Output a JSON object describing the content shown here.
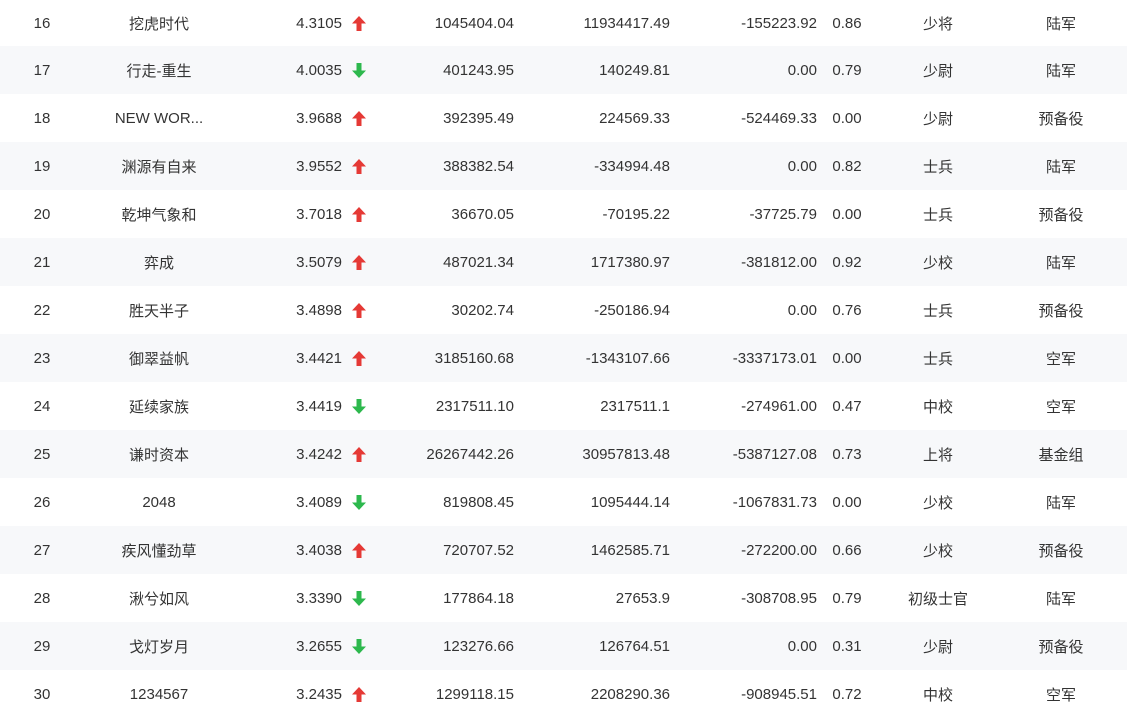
{
  "colors": {
    "up": "#e53935",
    "down": "#2db84d",
    "stripe": "#f7f8fa"
  },
  "rows": [
    {
      "rank": "16",
      "name": "挖虎时代",
      "score": "4.3105",
      "trend": "up",
      "v1": "1045404.04",
      "v2": "11934417.49",
      "v3": "-155223.92",
      "ratio": "0.86",
      "title": "少将",
      "unit": "陆军"
    },
    {
      "rank": "17",
      "name": "行走-重生",
      "score": "4.0035",
      "trend": "down",
      "v1": "401243.95",
      "v2": "140249.81",
      "v3": "0.00",
      "ratio": "0.79",
      "title": "少尉",
      "unit": "陆军"
    },
    {
      "rank": "18",
      "name": "NEW WOR...",
      "score": "3.9688",
      "trend": "up",
      "v1": "392395.49",
      "v2": "224569.33",
      "v3": "-524469.33",
      "ratio": "0.00",
      "title": "少尉",
      "unit": "预备役"
    },
    {
      "rank": "19",
      "name": "渊源有自来",
      "score": "3.9552",
      "trend": "up",
      "v1": "388382.54",
      "v2": "-334994.48",
      "v3": "0.00",
      "ratio": "0.82",
      "title": "士兵",
      "unit": "陆军"
    },
    {
      "rank": "20",
      "name": "乾坤气象和",
      "score": "3.7018",
      "trend": "up",
      "v1": "36670.05",
      "v2": "-70195.22",
      "v3": "-37725.79",
      "ratio": "0.00",
      "title": "士兵",
      "unit": "预备役"
    },
    {
      "rank": "21",
      "name": "弈成",
      "score": "3.5079",
      "trend": "up",
      "v1": "487021.34",
      "v2": "1717380.97",
      "v3": "-381812.00",
      "ratio": "0.92",
      "title": "少校",
      "unit": "陆军"
    },
    {
      "rank": "22",
      "name": "胜天半子",
      "score": "3.4898",
      "trend": "up",
      "v1": "30202.74",
      "v2": "-250186.94",
      "v3": "0.00",
      "ratio": "0.76",
      "title": "士兵",
      "unit": "预备役"
    },
    {
      "rank": "23",
      "name": "御翠益帆",
      "score": "3.4421",
      "trend": "up",
      "v1": "3185160.68",
      "v2": "-1343107.66",
      "v3": "-3337173.01",
      "ratio": "0.00",
      "title": "士兵",
      "unit": "空军"
    },
    {
      "rank": "24",
      "name": "延续家族",
      "score": "3.4419",
      "trend": "down",
      "v1": "2317511.10",
      "v2": "2317511.1",
      "v3": "-274961.00",
      "ratio": "0.47",
      "title": "中校",
      "unit": "空军"
    },
    {
      "rank": "25",
      "name": "谦时资本",
      "score": "3.4242",
      "trend": "up",
      "v1": "26267442.26",
      "v2": "30957813.48",
      "v3": "-5387127.08",
      "ratio": "0.73",
      "title": "上将",
      "unit": "基金组"
    },
    {
      "rank": "26",
      "name": "2048",
      "score": "3.4089",
      "trend": "down",
      "v1": "819808.45",
      "v2": "1095444.14",
      "v3": "-1067831.73",
      "ratio": "0.00",
      "title": "少校",
      "unit": "陆军"
    },
    {
      "rank": "27",
      "name": "疾风懂劲草",
      "score": "3.4038",
      "trend": "up",
      "v1": "720707.52",
      "v2": "1462585.71",
      "v3": "-272200.00",
      "ratio": "0.66",
      "title": "少校",
      "unit": "预备役"
    },
    {
      "rank": "28",
      "name": "湫兮如风",
      "score": "3.3390",
      "trend": "down",
      "v1": "177864.18",
      "v2": "27653.9",
      "v3": "-308708.95",
      "ratio": "0.79",
      "title": "初级士官",
      "unit": "陆军"
    },
    {
      "rank": "29",
      "name": "戈灯岁月",
      "score": "3.2655",
      "trend": "down",
      "v1": "123276.66",
      "v2": "126764.51",
      "v3": "0.00",
      "ratio": "0.31",
      "title": "少尉",
      "unit": "预备役"
    },
    {
      "rank": "30",
      "name": "1234567",
      "score": "3.2435",
      "trend": "up",
      "v1": "1299118.15",
      "v2": "2208290.36",
      "v3": "-908945.51",
      "ratio": "0.72",
      "title": "中校",
      "unit": "空军"
    }
  ]
}
